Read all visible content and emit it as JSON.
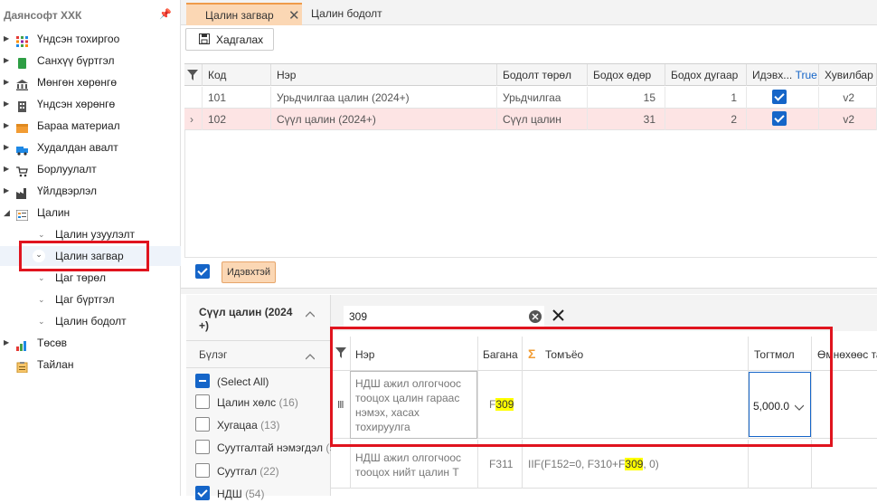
{
  "sidebar": {
    "title": "Даянсофт ХХК",
    "items": [
      {
        "label": "Үндсэн тохиргоо"
      },
      {
        "label": "Санхүү бүртгэл"
      },
      {
        "label": "Мөнгөн хөрөнгө"
      },
      {
        "label": "Үндсэн хөрөнгө"
      },
      {
        "label": "Бараа материал"
      },
      {
        "label": "Худалдан авалт"
      },
      {
        "label": "Борлуулалт"
      },
      {
        "label": "Үйлдвэрлэл"
      },
      {
        "label": "Цалин"
      },
      {
        "label": "Цалин узуулэлт"
      },
      {
        "label": "Цалин загвар"
      },
      {
        "label": "Цаг төрөл"
      },
      {
        "label": "Цаг бүртгэл"
      },
      {
        "label": "Цалин бодолт"
      },
      {
        "label": "Төсөв"
      },
      {
        "label": "Тайлан"
      }
    ]
  },
  "tabs": [
    {
      "label": "Цалин загвар"
    },
    {
      "label": "Цалин бодолт"
    }
  ],
  "toolbar": {
    "save_label": "Хадгалах"
  },
  "top_grid": {
    "columns": [
      "Код",
      "Нэр",
      "Бодолт төрөл",
      "Бодох өдөр",
      "Бодох дугаар",
      "Идэвх...",
      "True",
      "Хувилбар"
    ],
    "rows": [
      {
        "code": "101",
        "name": "Урьдчилгаа цалин (2024+)",
        "type": "Урьдчилгаа",
        "day": "15",
        "number": "1",
        "version": "v2"
      },
      {
        "code": "102",
        "name": "Сүүл цалин (2024+)",
        "type": "Сүүл цалин",
        "day": "31",
        "number": "2",
        "version": "v2"
      }
    ],
    "filter_chip": "Идэвхтэй"
  },
  "filter_panel": {
    "title": "Сүүл цалин (2024 +)",
    "group_label": "Бүлэг",
    "options": [
      {
        "label": "(Select All)",
        "count": ""
      },
      {
        "label": "Цалин хөлс",
        "count": "(16)"
      },
      {
        "label": "Хугацаа",
        "count": "(13)"
      },
      {
        "label": "Суутгалтай нэмэгдэл",
        "count": "(5"
      },
      {
        "label": "Суутгал",
        "count": "(22)"
      },
      {
        "label": "НДШ",
        "count": "(54)"
      }
    ]
  },
  "search": {
    "value": "309"
  },
  "bottom_grid": {
    "columns": [
      "Нэр",
      "Багана",
      "Томъёо",
      "Тогтмол",
      "Өмнөхөөс та"
    ],
    "rows": [
      {
        "name": "НДШ ажил олгогчоос тооцох цалин гараас нэмэх, хасах тохируулга",
        "col_prefix": "F",
        "col_hl": "309",
        "formula": "",
        "fixed": "5,000.0"
      },
      {
        "name": "НДШ ажил олгогчоос тооцох нийт цалин Т",
        "col": "F311",
        "formula_pre": "IIF(F152=0, F310+F",
        "formula_hl": "309",
        "formula_post": ", 0)"
      }
    ]
  },
  "colors": {
    "accent": "#1565c8",
    "highlight": "#e0141e",
    "tab_active": "#fbd7b4",
    "selected_row": "#fde4e4",
    "search_hl": "#ffff00"
  }
}
